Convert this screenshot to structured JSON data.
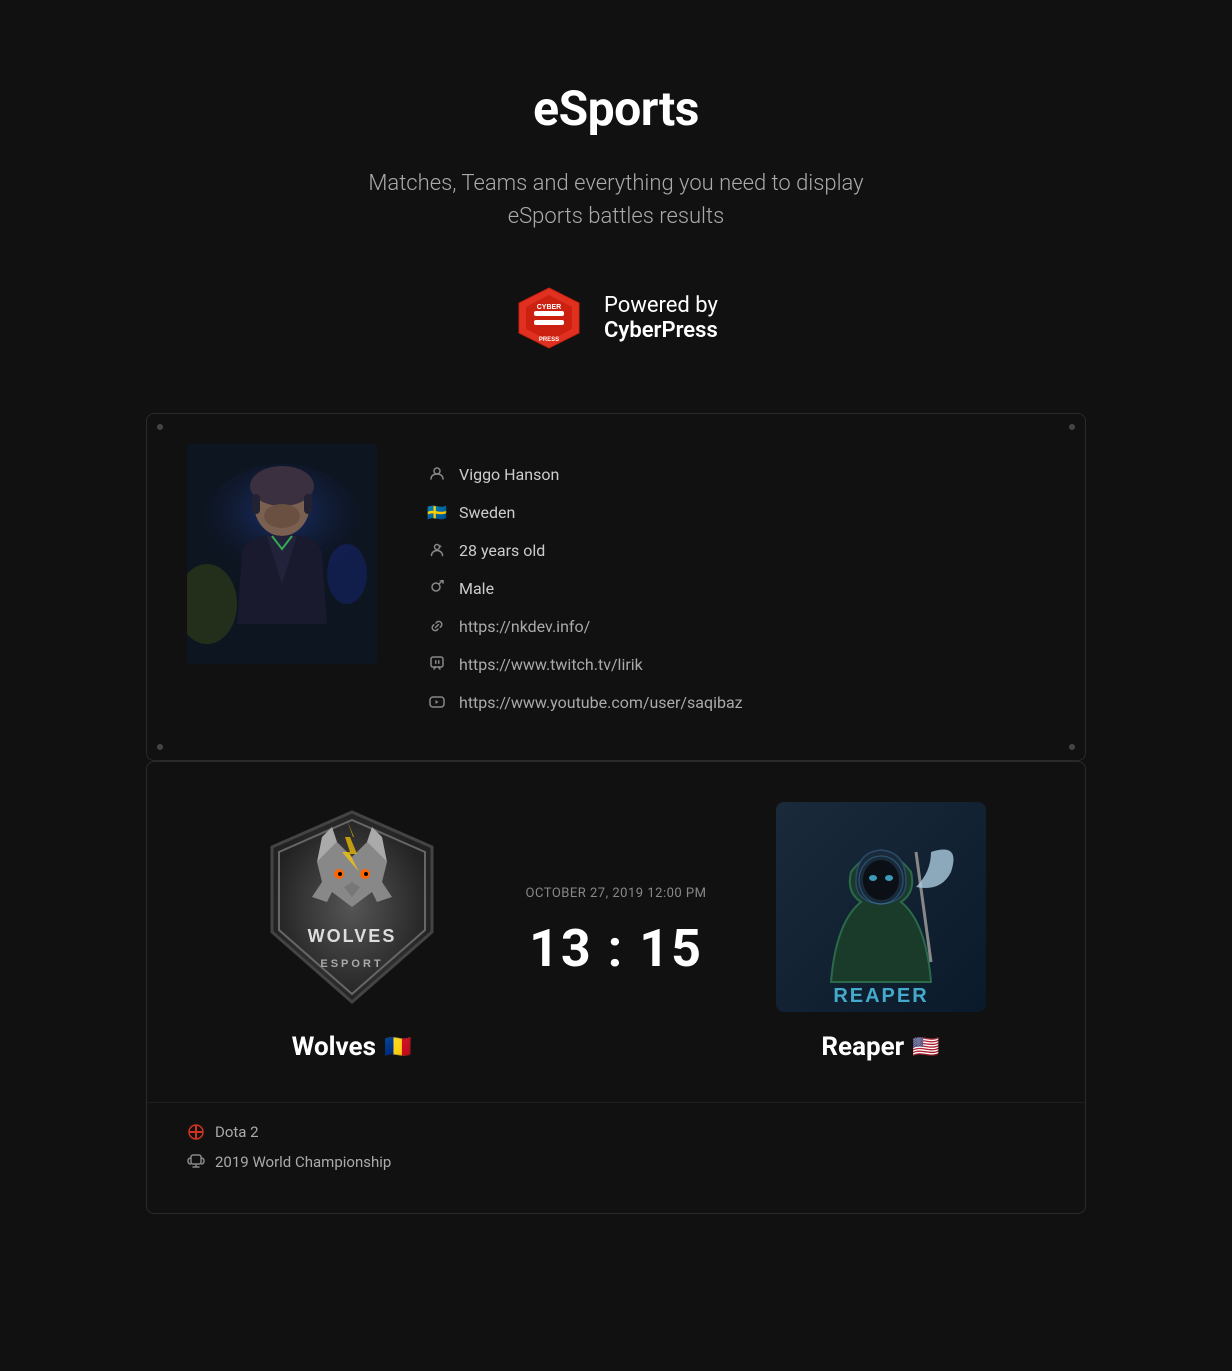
{
  "hero": {
    "title": "eSports",
    "subtitle": "Matches, Teams and everything you need to display eSports battles results",
    "powered_by_label": "Powered by",
    "powered_by_brand": "CyberPress"
  },
  "player": {
    "name": "Viggo Hanson",
    "country": "Sweden",
    "country_flag": "🇸🇪",
    "age": "28 years old",
    "gender": "Male",
    "website": "https://nkdev.info/",
    "twitch": "https://www.twitch.tv/lirik",
    "youtube": "https://www.youtube.com/user/saqibaz"
  },
  "match": {
    "datetime": "OCTOBER 27, 2019 12:00 PM",
    "score": "13 : 15",
    "team1": {
      "name": "Wolves",
      "flag": "🇷🇴"
    },
    "team2": {
      "name": "Reaper",
      "flag": "🇺🇸"
    },
    "game": "Dota 2",
    "tournament": "2019 World Championship"
  }
}
